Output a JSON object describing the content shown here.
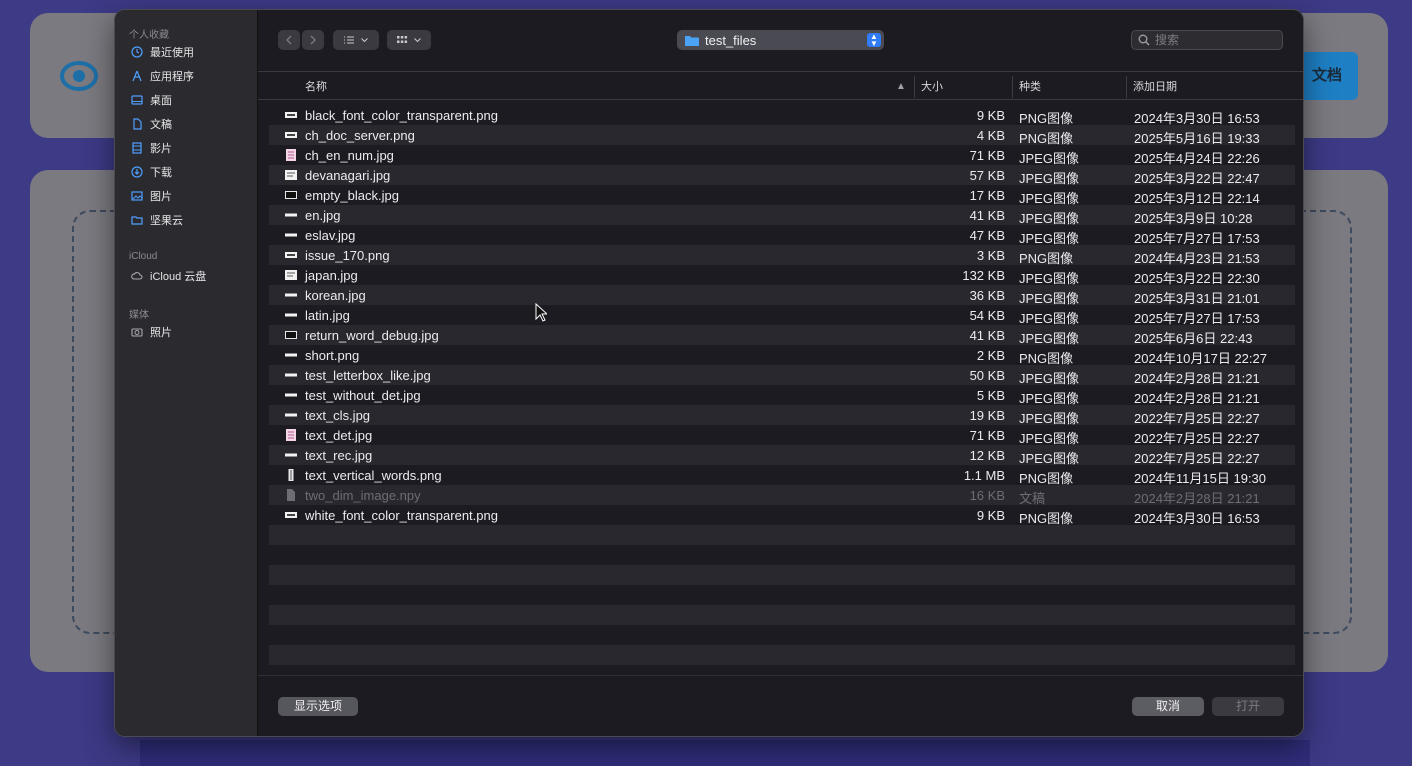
{
  "background": {
    "doc_button": "文档"
  },
  "sidebar": {
    "sections": [
      {
        "title": "个人收藏",
        "items": [
          {
            "label": "最近使用",
            "icon": "clock-icon"
          },
          {
            "label": "应用程序",
            "icon": "apps-icon"
          },
          {
            "label": "桌面",
            "icon": "desktop-icon"
          },
          {
            "label": "文稿",
            "icon": "document-icon"
          },
          {
            "label": "影片",
            "icon": "film-icon"
          },
          {
            "label": "下载",
            "icon": "download-icon"
          },
          {
            "label": "图片",
            "icon": "image-icon"
          },
          {
            "label": "坚果云",
            "icon": "folder-icon"
          }
        ]
      },
      {
        "title": "iCloud",
        "items": [
          {
            "label": "iCloud 云盘",
            "icon": "cloud-icon"
          }
        ]
      },
      {
        "title": "媒体",
        "items": [
          {
            "label": "照片",
            "icon": "camera-icon"
          }
        ]
      }
    ]
  },
  "toolbar": {
    "folder": "test_files",
    "search_placeholder": "搜索"
  },
  "columns": {
    "name": "名称",
    "size": "大小",
    "kind": "种类",
    "date_added": "添加日期"
  },
  "files": [
    {
      "name": "black_font_color_transparent.png",
      "size": "9 KB",
      "kind": "PNG图像",
      "date": "2024年3月30日 16:53",
      "icon": "png-thumb"
    },
    {
      "name": "ch_doc_server.png",
      "size": "4 KB",
      "kind": "PNG图像",
      "date": "2025年5月16日 19:33",
      "icon": "png-thumb"
    },
    {
      "name": "ch_en_num.jpg",
      "size": "71 KB",
      "kind": "JPEG图像",
      "date": "2025年4月24日 22:26",
      "icon": "jpg-pink-thumb"
    },
    {
      "name": "devanagari.jpg",
      "size": "57 KB",
      "kind": "JPEG图像",
      "date": "2025年3月22日 22:47",
      "icon": "jpg-thumb"
    },
    {
      "name": "empty_black.jpg",
      "size": "17 KB",
      "kind": "JPEG图像",
      "date": "2025年3月12日 22:14",
      "icon": "jpg-outline-thumb"
    },
    {
      "name": "en.jpg",
      "size": "41 KB",
      "kind": "JPEG图像",
      "date": "2025年3月9日 10:28",
      "icon": "strip-thumb"
    },
    {
      "name": "eslav.jpg",
      "size": "47 KB",
      "kind": "JPEG图像",
      "date": "2025年7月27日 17:53",
      "icon": "strip-thumb"
    },
    {
      "name": "issue_170.png",
      "size": "3 KB",
      "kind": "PNG图像",
      "date": "2024年4月23日 21:53",
      "icon": "png-thumb"
    },
    {
      "name": "japan.jpg",
      "size": "132 KB",
      "kind": "JPEG图像",
      "date": "2025年3月22日 22:30",
      "icon": "jpg-thumb"
    },
    {
      "name": "korean.jpg",
      "size": "36 KB",
      "kind": "JPEG图像",
      "date": "2025年3月31日 21:01",
      "icon": "strip-thumb"
    },
    {
      "name": "latin.jpg",
      "size": "54 KB",
      "kind": "JPEG图像",
      "date": "2025年7月27日 17:53",
      "icon": "strip-thumb"
    },
    {
      "name": "return_word_debug.jpg",
      "size": "41 KB",
      "kind": "JPEG图像",
      "date": "2025年6月6日 22:43",
      "icon": "jpg-outline-thumb"
    },
    {
      "name": "short.png",
      "size": "2 KB",
      "kind": "PNG图像",
      "date": "2024年10月17日 22:27",
      "icon": "strip-thumb"
    },
    {
      "name": "test_letterbox_like.jpg",
      "size": "50 KB",
      "kind": "JPEG图像",
      "date": "2024年2月28日 21:21",
      "icon": "strip-thumb"
    },
    {
      "name": "test_without_det.jpg",
      "size": "5 KB",
      "kind": "JPEG图像",
      "date": "2024年2月28日 21:21",
      "icon": "strip-thumb"
    },
    {
      "name": "text_cls.jpg",
      "size": "19 KB",
      "kind": "JPEG图像",
      "date": "2022年7月25日 22:27",
      "icon": "strip-thumb"
    },
    {
      "name": "text_det.jpg",
      "size": "71 KB",
      "kind": "JPEG图像",
      "date": "2022年7月25日 22:27",
      "icon": "jpg-pink-thumb"
    },
    {
      "name": "text_rec.jpg",
      "size": "12 KB",
      "kind": "JPEG图像",
      "date": "2022年7月25日 22:27",
      "icon": "strip-thumb"
    },
    {
      "name": "text_vertical_words.png",
      "size": "1.1 MB",
      "kind": "PNG图像",
      "date": "2024年11月15日 19:30",
      "icon": "vertical-thumb"
    },
    {
      "name": "two_dim_image.npy",
      "size": "16 KB",
      "kind": "文稿",
      "date": "2024年2月28日 21:21",
      "icon": "generic-doc-icon",
      "disabled": true
    },
    {
      "name": "white_font_color_transparent.png",
      "size": "9 KB",
      "kind": "PNG图像",
      "date": "2024年3月30日 16:53",
      "icon": "png-thumb"
    }
  ],
  "buttons": {
    "options": "显示选项",
    "cancel": "取消",
    "open": "打开"
  }
}
